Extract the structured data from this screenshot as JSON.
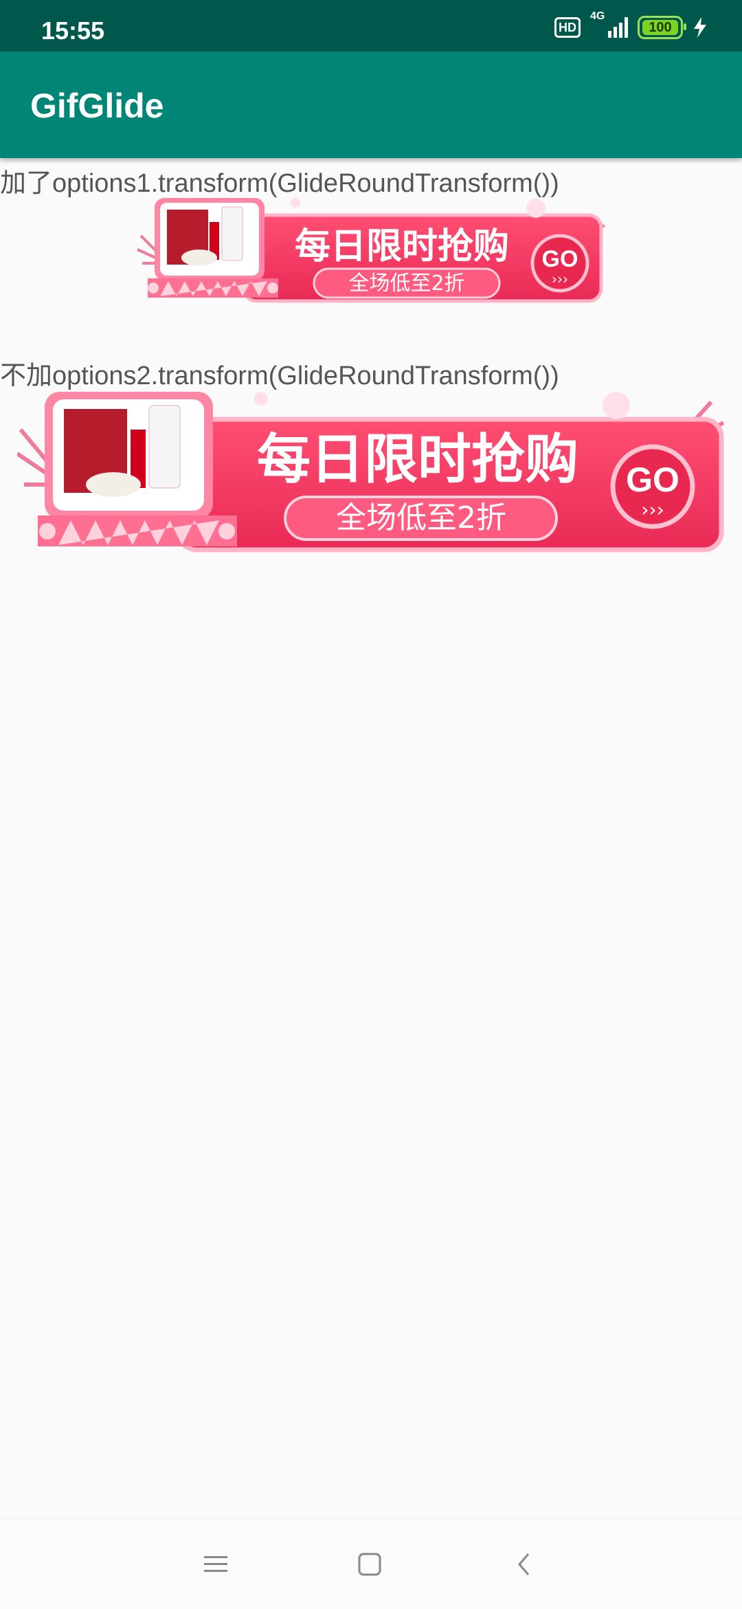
{
  "status_bar": {
    "time": "15:55",
    "hd_badge": "HD",
    "network_type": "4G",
    "battery_level": "100",
    "icons": [
      "hd-icon",
      "signal-icon",
      "battery-icon",
      "charging-icon"
    ]
  },
  "app_bar": {
    "title": "GifGlide"
  },
  "sections": [
    {
      "caption": "加了options1.transform(GlideRoundTransform())",
      "banner": {
        "headline": "每日限时抢购",
        "subline": "全场低至2折",
        "go_label": "GO",
        "arrows": "›››"
      }
    },
    {
      "caption": "不加options2.transform(GlideRoundTransform())",
      "banner": {
        "headline": "每日限时抢购",
        "subline": "全场低至2折",
        "go_label": "GO",
        "arrows": "›››"
      }
    }
  ],
  "nav_bar": {
    "buttons": [
      "menu-icon",
      "home-icon",
      "back-icon"
    ]
  },
  "colors": {
    "status_bar": "#00574b",
    "app_bar": "#008577",
    "banner_red": "#f0385f",
    "banner_pink": "#ff9ab5"
  }
}
